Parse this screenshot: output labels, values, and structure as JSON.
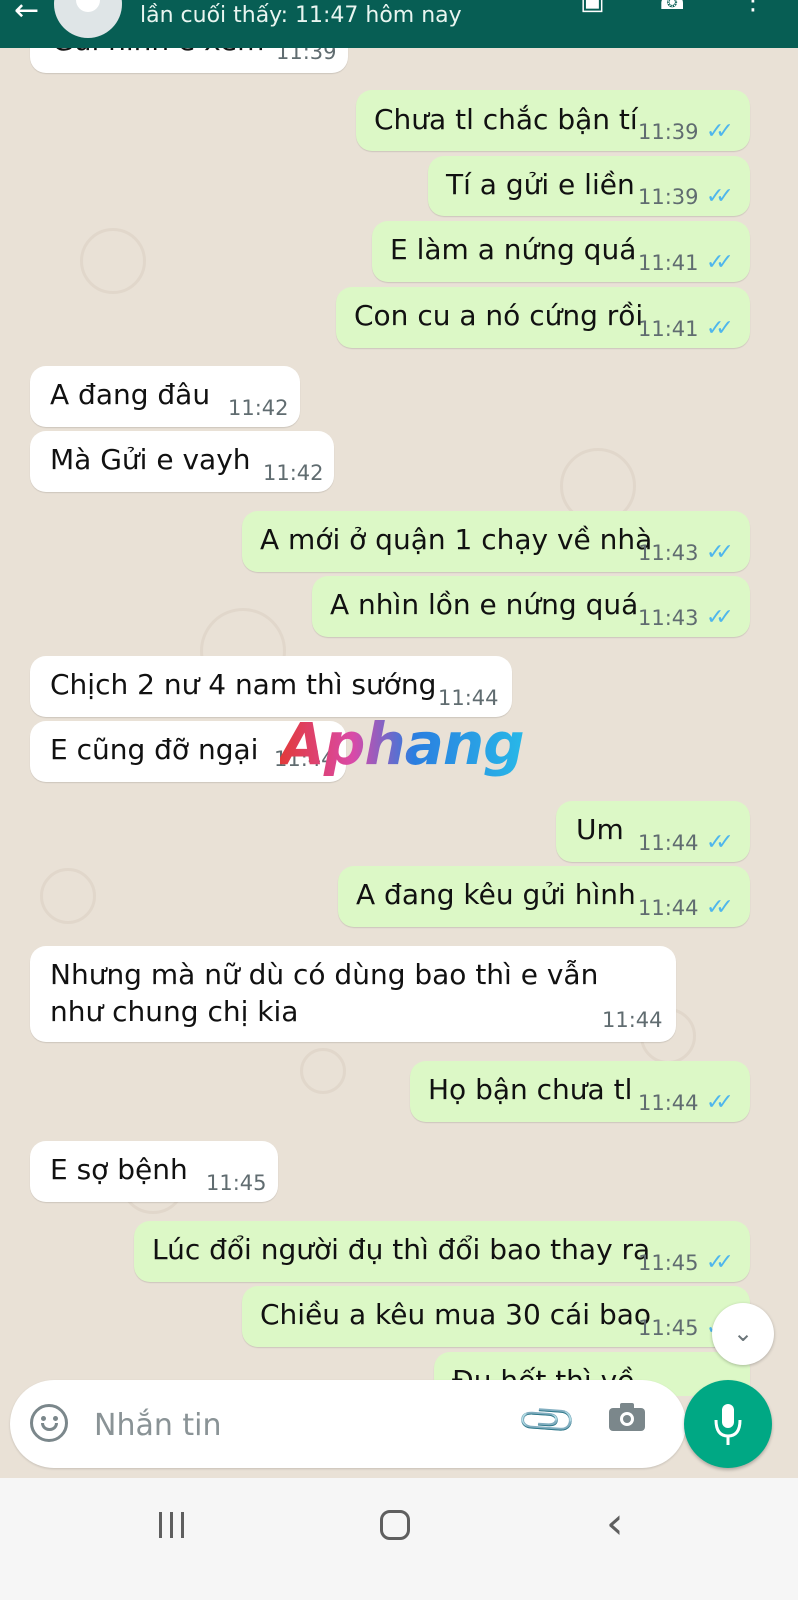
{
  "header": {
    "last_seen": "lần cuối thấy: 11:47 hôm nay",
    "icons": [
      "back-arrow-icon",
      "avatar",
      "video-call-icon",
      "voice-call-icon",
      "more-options-icon"
    ],
    "color": "#075e54"
  },
  "messages": [
    {
      "dir": "in",
      "text": "Gửi hình e xem",
      "time": "11:39"
    },
    {
      "dir": "out",
      "text": "Chưa tl chắc bận tí",
      "time": "11:39",
      "read": true
    },
    {
      "dir": "out",
      "text": "Tí a gửi e liền",
      "time": "11:39",
      "read": true
    },
    {
      "dir": "out",
      "text": "E làm a nứng quá",
      "time": "11:41",
      "read": true
    },
    {
      "dir": "out",
      "text": "Con cu a nó cứng rồi",
      "time": "11:41",
      "read": true
    },
    {
      "dir": "in",
      "text": "A đang đâu",
      "time": "11:42"
    },
    {
      "dir": "in",
      "text": "Mà Gửi e vayh",
      "time": "11:42"
    },
    {
      "dir": "out",
      "text": "A mới ở quận 1 chạy về nhà",
      "time": "11:43",
      "read": true
    },
    {
      "dir": "out",
      "text": "A nhìn lồn e nứng quá",
      "time": "11:43",
      "read": true
    },
    {
      "dir": "in",
      "text": "Chịch 2 nư 4 nam thì sướng",
      "time": "11:44"
    },
    {
      "dir": "in",
      "text": "E cũng đỡ ngại",
      "time": "11:44"
    },
    {
      "dir": "out",
      "text": "Um",
      "time": "11:44",
      "read": true
    },
    {
      "dir": "out",
      "text": "A đang kêu gửi hình",
      "time": "11:44",
      "read": true
    },
    {
      "dir": "in",
      "text": "Nhưng mà nữ dù có dùng bao thì e vẫn như chung chị kia",
      "time": "11:44"
    },
    {
      "dir": "out",
      "text": "Họ bận chưa tl",
      "time": "11:44",
      "read": true
    },
    {
      "dir": "in",
      "text": "E sợ bệnh",
      "time": "11:45"
    },
    {
      "dir": "out",
      "text": "Lúc đổi người đụ thì đổi bao thay ra",
      "time": "11:45",
      "read": true
    },
    {
      "dir": "out",
      "text": "Chiều a kêu mua 30 cái bao",
      "time": "11:45",
      "read": true
    },
    {
      "dir": "out",
      "text": "Đụ hết thì về",
      "time": ""
    }
  ],
  "watermark": "Aphang",
  "composer": {
    "placeholder": "Nhắn tin",
    "icons": [
      "emoji-icon",
      "attach-icon",
      "camera-icon",
      "mic-icon"
    ]
  },
  "scroll_icon": "double-chevron-down-icon",
  "nav_bar": {
    "icons": [
      "recent-apps-icon",
      "home-icon",
      "back-icon"
    ]
  },
  "colors": {
    "outgoing_bubble": "#dcf8c6",
    "incoming_bubble": "#ffffff",
    "read_ticks": "#4fb6ec",
    "mic_button": "#00a884"
  }
}
